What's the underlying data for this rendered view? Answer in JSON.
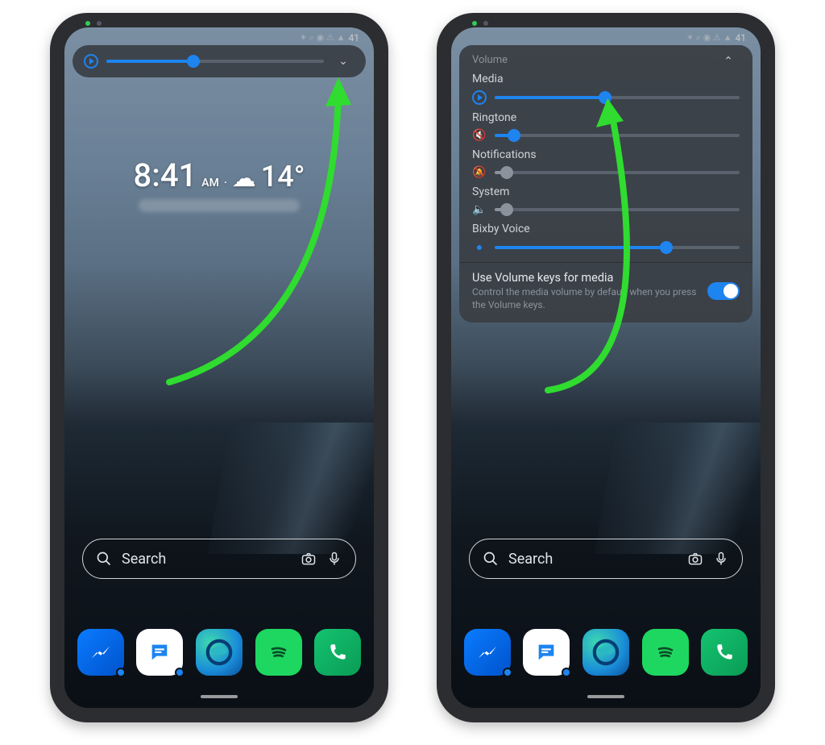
{
  "status": {
    "time": "41",
    "icons": "✶ ⌕ ◉ ⚠ ▲"
  },
  "weather": {
    "time": "8:41",
    "ampm": "AM",
    "sep": "·",
    "degrees": "14°"
  },
  "search": {
    "placeholder": "Search"
  },
  "volSlim": {
    "value_pct": 40
  },
  "volPanel": {
    "title": "Volume",
    "rows": {
      "media": {
        "label": "Media",
        "value_pct": 45,
        "active": true
      },
      "ringtone": {
        "label": "Ringtone",
        "value_pct": 8,
        "active": true
      },
      "notifications": {
        "label": "Notifications",
        "value_pct": 5,
        "active": false
      },
      "system": {
        "label": "System",
        "value_pct": 5,
        "active": false
      },
      "bixby": {
        "label": "Bixby Voice",
        "value_pct": 70,
        "active": true
      }
    },
    "toggle": {
      "title": "Use Volume keys for media",
      "sub": "Control the media volume by default when you press the Volume keys.",
      "on": true
    }
  },
  "dock": {
    "apps": [
      {
        "name": "messenger",
        "glyph": "⚡",
        "badge": true
      },
      {
        "name": "messages",
        "glyph": "✉",
        "badge": true
      },
      {
        "name": "edge",
        "glyph": "◎",
        "badge": false
      },
      {
        "name": "spotify",
        "glyph": "♪",
        "badge": false
      },
      {
        "name": "phone",
        "glyph": "✆",
        "badge": false
      }
    ]
  }
}
